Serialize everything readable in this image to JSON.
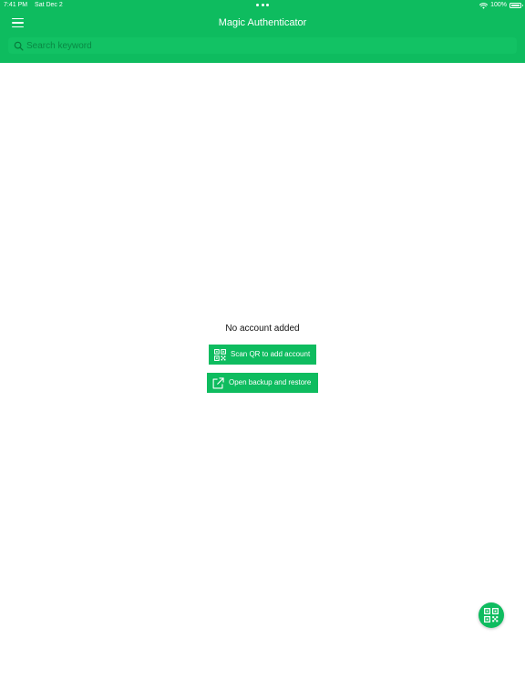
{
  "status_bar": {
    "time": "7:41 PM",
    "date": "Sat Dec 2",
    "battery_percent": "100%"
  },
  "header": {
    "title": "Magic Authenticator",
    "menu_icon": "hamburger-menu-icon"
  },
  "search": {
    "placeholder": "Search keyword",
    "value": "",
    "icon": "search-icon"
  },
  "empty_state": {
    "message": "No account added",
    "scan_button_label": "Scan QR to add account",
    "scan_button_icon": "qr-code-icon",
    "backup_button_label": "Open backup and restore",
    "backup_button_icon": "external-link-icon"
  },
  "fab": {
    "icon": "qr-code-icon"
  },
  "colors": {
    "accent": "#0ebc5f",
    "background": "#ffffff",
    "text": "#111111"
  }
}
